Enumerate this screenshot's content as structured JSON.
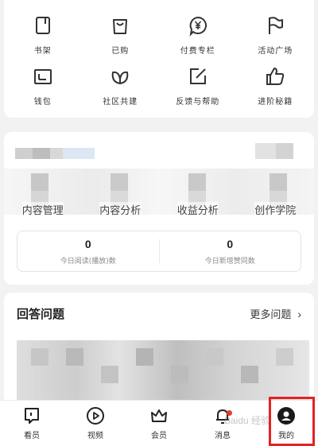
{
  "grid": [
    {
      "label": "书架",
      "icon": "book-icon"
    },
    {
      "label": "已购",
      "icon": "bag-icon"
    },
    {
      "label": "付费专栏",
      "icon": "yen-bubble-icon"
    },
    {
      "label": "活动广场",
      "icon": "flag-icon"
    },
    {
      "label": "钱包",
      "icon": "wallet-icon"
    },
    {
      "label": "社区共建",
      "icon": "leaf-icon"
    },
    {
      "label": "反馈与帮助",
      "icon": "edit-icon"
    },
    {
      "label": "进阶秘籍",
      "icon": "thumbs-up-icon"
    }
  ],
  "creator": {
    "nav": [
      "内容管理",
      "内容分析",
      "收益分析",
      "创作学院"
    ],
    "stats": [
      {
        "value": "0",
        "label": "今日阅读(播放)数"
      },
      {
        "value": "0",
        "label": "今日新增赞同数"
      }
    ]
  },
  "answer": {
    "title": "回答问题",
    "more": "更多问题"
  },
  "tabbar": [
    {
      "label": "看员",
      "icon": "bookmark-icon"
    },
    {
      "label": "视频",
      "icon": "play-icon"
    },
    {
      "label": "会员",
      "icon": "crown-icon"
    },
    {
      "label": "消息",
      "icon": "bell-icon"
    },
    {
      "label": "我的",
      "icon": "profile-icon"
    }
  ],
  "watermark": "Baidu 经验",
  "colors": {
    "accent": "#e32222",
    "badge": "#e53935"
  }
}
